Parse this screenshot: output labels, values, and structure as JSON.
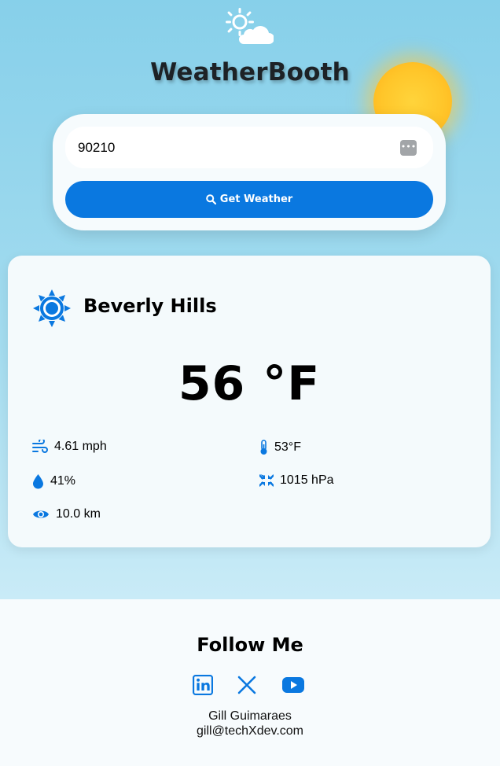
{
  "header": {
    "title": "WeatherBooth",
    "logo_icon": "sun-cloud-icon"
  },
  "search": {
    "value": "90210",
    "button_label": "Get Weather",
    "button_icon": "search-icon",
    "autofill_icon": "autofill-icon"
  },
  "weather": {
    "icon": "sun-icon",
    "city": "Beverly Hills",
    "temperature": "56 °F",
    "wind": "4.61 mph",
    "feels_like": "53°F",
    "humidity": "41%",
    "pressure": "1015 hPa",
    "visibility": "10.0 km"
  },
  "footer": {
    "follow_title": "Follow Me",
    "social": [
      "linkedin-icon",
      "x-icon",
      "youtube-icon"
    ],
    "author_name": "Gill Guimaraes",
    "author_email": "gill@techXdev.com"
  },
  "colors": {
    "accent": "#0a78e0",
    "sun": "#ffc62a"
  }
}
